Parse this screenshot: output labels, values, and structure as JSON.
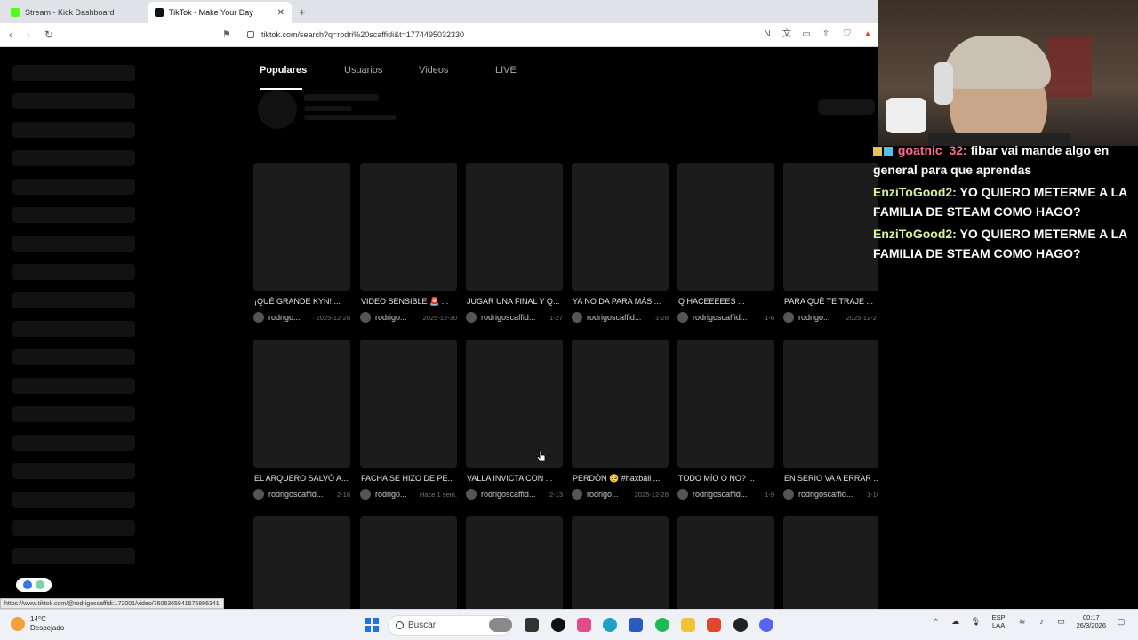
{
  "browser": {
    "tabs": [
      {
        "title": "Stream - Kick Dashboard",
        "favicon": "kick-icon",
        "active": false
      },
      {
        "title": "TikTok - Make Your Day",
        "favicon": "tiktok-icon",
        "active": true
      }
    ],
    "url": "tiktok.com/search?q=rodri%20scaffidi&t=1774495032330",
    "status_url": "https://www.tiktok.com/@rodrigoscaffidi:172001/video/7606365941575896341"
  },
  "tiktok": {
    "search_tabs": [
      {
        "label": "Populares",
        "active": true
      },
      {
        "label": "Usuarios",
        "active": false
      },
      {
        "label": "Videos",
        "active": false
      },
      {
        "label": "LIVE",
        "active": false
      }
    ],
    "videos": [
      {
        "caption": "¡QUÉ GRANDE KYN! ...",
        "user": "rodrigo...",
        "date": "2025-12-28"
      },
      {
        "caption": "VIDEO SENSIBLE 🚨 ...",
        "user": "rodrigo...",
        "date": "2025-12-30"
      },
      {
        "caption": "JUGAR UNA FINAL Y Q...",
        "user": "rodrigoscaffid...",
        "date": "1-27"
      },
      {
        "caption": "YA NO DA PARA MÁS ...",
        "user": "rodrigoscaffid...",
        "date": "1-28"
      },
      {
        "caption": "Q HACEEEEES ...",
        "user": "rodrigoscaffid...",
        "date": "1-6"
      },
      {
        "caption": "PARA QUÉ TE TRAJE ...",
        "user": "rodrigo...",
        "date": "2025-12-27"
      },
      {
        "caption": "EL ARQUERO SALVÓ A...",
        "user": "rodrigoscaffid...",
        "date": "2-18"
      },
      {
        "caption": "FACHA SE HIZO DE PE...",
        "user": "rodrigo...",
        "date": "Hace 1 sem."
      },
      {
        "caption": "VALLA INVICTA CON ...",
        "user": "rodrigoscaffid...",
        "date": "2-13"
      },
      {
        "caption": "PERDÓN 🥺 #haxball ...",
        "user": "rodrigo...",
        "date": "2025-12-28"
      },
      {
        "caption": "TODO MÍO O NO? ...",
        "user": "rodrigoscaffid...",
        "date": "1-9"
      },
      {
        "caption": "EN SERIO VA A ERRAR ...",
        "user": "rodrigoscaffid...",
        "date": "1-10"
      },
      {
        "caption": "",
        "user": "",
        "date": ""
      },
      {
        "caption": "",
        "user": "",
        "date": ""
      },
      {
        "caption": "",
        "user": "",
        "date": ""
      },
      {
        "caption": "",
        "user": "",
        "date": ""
      },
      {
        "caption": "",
        "user": "",
        "date": ""
      },
      {
        "caption": "",
        "user": "",
        "date": ""
      }
    ]
  },
  "chat": {
    "messages": [
      {
        "user": "goatnic_32:",
        "text": "fibar vai mande algo en general para que aprendas"
      },
      {
        "user": "EnziToGood2:",
        "text": "YO QUIERO METERME A LA FAMILIA DE STEAM COMO HAGO?"
      },
      {
        "user": "EnziToGood2:",
        "text": "YO QUIERO METERME A LA FAMILIA DE STEAM COMO HAGO?"
      }
    ]
  },
  "taskbar": {
    "weather_temp": "14°C",
    "weather_desc": "Despejado",
    "search_placeholder": "Buscar",
    "lang": "ESP",
    "lang2": "LAA",
    "time": "00:17",
    "date": "26/3/2026"
  },
  "colors": {
    "chat_username": "#d8f59a",
    "chat_username_alt": "#ff6b8b",
    "thumb_bg": "#1c1c1c"
  }
}
